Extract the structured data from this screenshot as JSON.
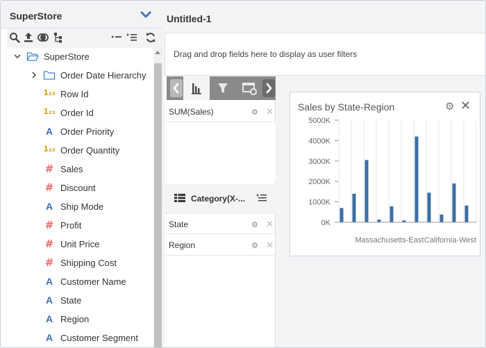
{
  "left": {
    "title": "SuperStore",
    "tree": [
      {
        "label": "SuperStore",
        "type": "folder-open",
        "expand": "down",
        "level": 0
      },
      {
        "label": "Order Date Hierarchy",
        "type": "folder",
        "expand": "right",
        "level": 1
      },
      {
        "label": "Row Id",
        "type": "number",
        "level": 1
      },
      {
        "label": "Order Id",
        "type": "number",
        "level": 1
      },
      {
        "label": "Order Priority",
        "type": "text",
        "level": 1
      },
      {
        "label": "Order Quantity",
        "type": "number",
        "level": 1
      },
      {
        "label": "Sales",
        "type": "measure",
        "level": 1
      },
      {
        "label": "Discount",
        "type": "measure",
        "level": 1
      },
      {
        "label": "Ship Mode",
        "type": "text",
        "level": 1
      },
      {
        "label": "Profit",
        "type": "measure",
        "level": 1
      },
      {
        "label": "Unit Price",
        "type": "measure",
        "level": 1
      },
      {
        "label": "Shipping Cost",
        "type": "measure",
        "level": 1
      },
      {
        "label": "Customer Name",
        "type": "text",
        "level": 1
      },
      {
        "label": "State",
        "type": "text",
        "level": 1
      },
      {
        "label": "Region",
        "type": "text",
        "level": 1
      },
      {
        "label": "Customer Segment",
        "type": "text",
        "level": 1
      }
    ],
    "num_icon": "1₂₃",
    "hash_icon": "#",
    "a_icon": "A"
  },
  "main": {
    "title": "Untitled-1",
    "filter_placeholder": "Drag and drop fields here to display as user filters",
    "values_fields": [
      {
        "label": "SUM(Sales)"
      }
    ],
    "category_header": "Category(X-...",
    "category_fields": [
      {
        "label": "State"
      },
      {
        "label": "Region"
      }
    ]
  },
  "chart": {
    "title": "Sales by State-Region"
  },
  "chart_data": {
    "type": "bar",
    "title": "Sales by State-Region",
    "y_ticks": [
      "5000K",
      "4000K",
      "3000K",
      "2000K",
      "1000K",
      "0K"
    ],
    "ylim": [
      0,
      5000
    ],
    "x_tick_labels": [
      "Massachusetts-East",
      "California-West"
    ],
    "values": [
      700,
      1400,
      3050,
      130,
      780,
      90,
      4200,
      1450,
      380,
      1900,
      820
    ],
    "bar_color": "#3b6ea5",
    "grid": true
  },
  "colors": {
    "accent": "#3b6fb6",
    "measure": "#ef6b6b",
    "number": "#d4a017"
  }
}
